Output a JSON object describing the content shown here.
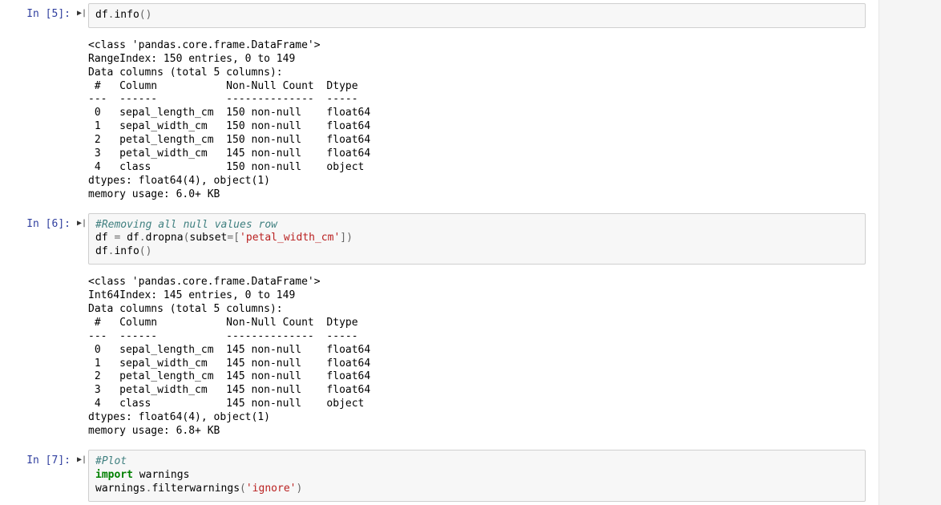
{
  "cells": [
    {
      "prompt": "In [5]:",
      "run_glyph": "▶|",
      "code_html": "<span class='tok-id'>df</span><span class='tok-op'>.</span><span class='tok-id'>info</span><span class='tok-op'>()</span>",
      "output": "<class 'pandas.core.frame.DataFrame'>\nRangeIndex: 150 entries, 0 to 149\nData columns (total 5 columns):\n #   Column           Non-Null Count  Dtype  \n---  ------           --------------  -----  \n 0   sepal_length_cm  150 non-null    float64\n 1   sepal_width_cm   150 non-null    float64\n 2   petal_length_cm  150 non-null    float64\n 3   petal_width_cm   145 non-null    float64\n 4   class            150 non-null    object \ndtypes: float64(4), object(1)\nmemory usage: 6.0+ KB"
    },
    {
      "prompt": "In [6]:",
      "run_glyph": "▶|",
      "code_html": "<span class='tok-cm'>#Removing all null values row</span>\n<span class='tok-id'>df</span> <span class='tok-op'>=</span> <span class='tok-id'>df</span><span class='tok-op'>.</span><span class='tok-id'>dropna</span><span class='tok-op'>(</span><span class='tok-id'>subset</span><span class='tok-op'>=[</span><span class='tok-str'>'petal_width_cm'</span><span class='tok-op'>])</span>\n<span class='tok-id'>df</span><span class='tok-op'>.</span><span class='tok-id'>info</span><span class='tok-op'>()</span>",
      "output": "<class 'pandas.core.frame.DataFrame'>\nInt64Index: 145 entries, 0 to 149\nData columns (total 5 columns):\n #   Column           Non-Null Count  Dtype  \n---  ------           --------------  -----  \n 0   sepal_length_cm  145 non-null    float64\n 1   sepal_width_cm   145 non-null    float64\n 2   petal_length_cm  145 non-null    float64\n 3   petal_width_cm   145 non-null    float64\n 4   class            145 non-null    object \ndtypes: float64(4), object(1)\nmemory usage: 6.8+ KB"
    },
    {
      "prompt": "In [7]:",
      "run_glyph": "▶|",
      "code_html": "<span class='tok-cm'>#Plot</span>\n<span class='tok-kw'>import</span> <span class='tok-id'>warnings</span>\n<span class='tok-id'>warnings</span><span class='tok-op'>.</span><span class='tok-id'>filterwarnings</span><span class='tok-op'>(</span><span class='tok-str'>'ignore'</span><span class='tok-op'>)</span>",
      "output": null
    }
  ]
}
